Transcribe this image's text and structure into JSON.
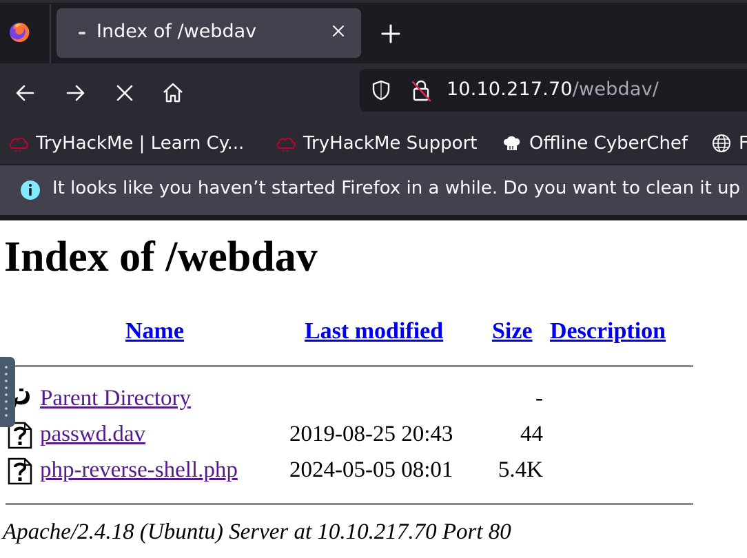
{
  "browser": {
    "tab": {
      "title": "Index of /webdav"
    },
    "url": {
      "host": "10.10.217.70",
      "path": "/webdav/"
    },
    "bookmarks": [
      {
        "label": "TryHackMe | Learn Cy...",
        "icon": "tryhackme-cloud-icon"
      },
      {
        "label": "TryHackMe Support",
        "icon": "tryhackme-cloud-icon"
      },
      {
        "label": "Offline CyberChef",
        "icon": "chef-hat-icon"
      },
      {
        "label": "F",
        "icon": "globe-icon"
      }
    ],
    "notification": {
      "message": "It looks like you haven’t started Firefox in a while. Do you want to clean it up"
    }
  },
  "page": {
    "heading": "Index of /webdav",
    "columns": {
      "name": "Name",
      "last_modified": "Last modified",
      "size": "Size",
      "description": "Description"
    },
    "rows": [
      {
        "name": "Parent Directory",
        "date": "",
        "size": "-",
        "icon": "back-arrow-icon"
      },
      {
        "name": "passwd.dav",
        "date": "2019-08-25 20:43",
        "size": "44",
        "icon": "unknown-file-icon"
      },
      {
        "name": "php-reverse-shell.php",
        "date": "2024-05-05 08:01",
        "size": "5.4K",
        "icon": "unknown-file-icon"
      }
    ],
    "footer": "Apache/2.4.18 (Ubuntu) Server at 10.10.217.70 Port 80"
  },
  "colors": {
    "link": "#0000ee",
    "visited": "#551a8b",
    "chrome_dark": "#1c1b22",
    "chrome": "#2b2a33",
    "tab_active": "#42414d"
  }
}
